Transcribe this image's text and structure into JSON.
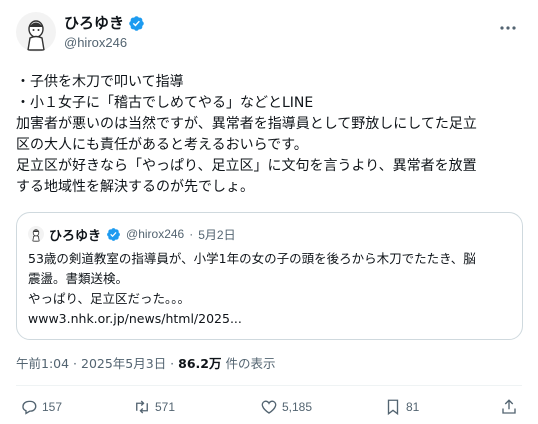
{
  "tweet": {
    "display_name": "ひろゆき",
    "handle": "@hirox246",
    "text_lines": [
      "・子供を木刀で叩いて指導",
      "・小１女子に「稽古でしめてやる」などとLINE",
      "加害者が悪いのは当然ですが、異常者を指導員として野放しにしてた足立",
      "区の大人にも責任があると考えるおいらです。",
      "足立区が好きなら「やっぱり、足立区」に文句を言うより、異常者を放置",
      "する地域性を解決するのが先でしょ。"
    ],
    "timestamp": "午前1:04 · 2025年5月3日 · ",
    "views_count": "86.2万",
    "views_label": " 件の表示"
  },
  "quote": {
    "display_name": "ひろゆき",
    "handle": "@hirox246",
    "separator": "·",
    "date": "5月2日",
    "body_lines": [
      "53歳の剣道教室の指導員が、小学1年の女の子の頭を後ろから木刀でたたき、脳",
      "震盪。書類送検。",
      "やっぱり、足立区だった。。。",
      "www3.nhk.or.jp/news/html/2025..."
    ]
  },
  "actions": {
    "reply_count": "157",
    "retweet_count": "571",
    "like_count": "5,185",
    "bookmark_count": "81"
  },
  "icons": {
    "verified": "verified-badge-icon",
    "more": "more-icon",
    "reply": "reply-icon",
    "retweet": "retweet-icon",
    "like": "like-icon",
    "bookmark": "bookmark-icon",
    "share": "share-icon"
  },
  "colors": {
    "verified_blue": "#1d9bf0",
    "secondary_text": "#536471",
    "border": "#cfd9de"
  }
}
